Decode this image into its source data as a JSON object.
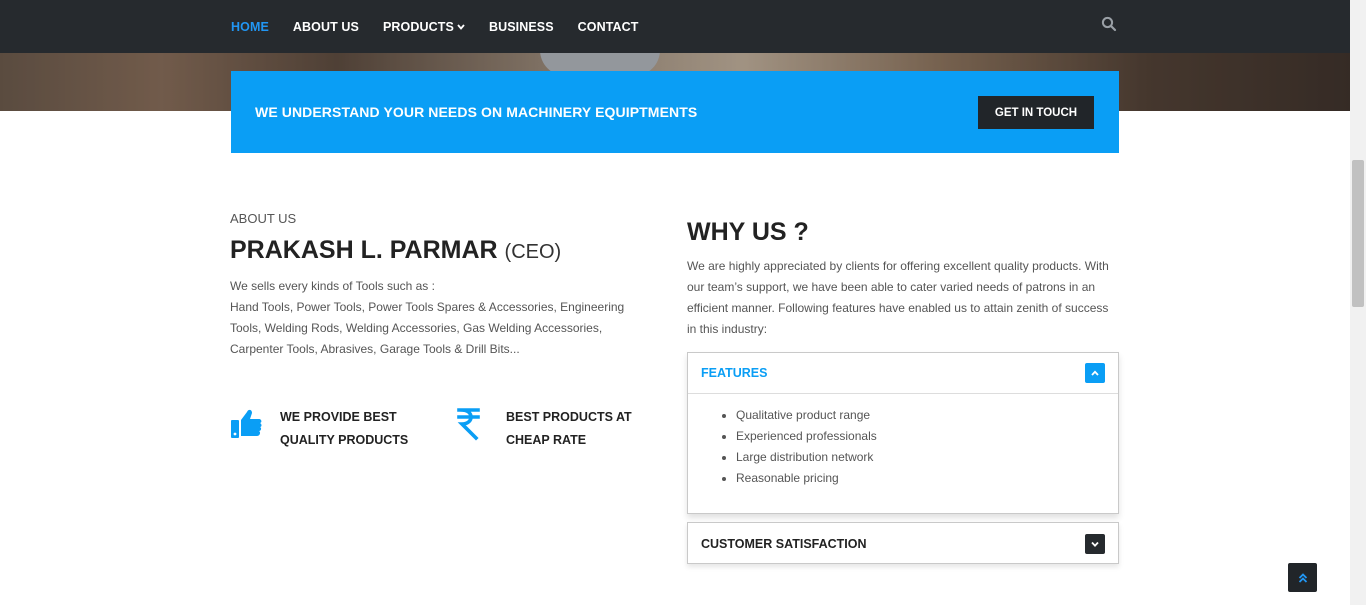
{
  "nav": {
    "items": [
      {
        "label": "HOME"
      },
      {
        "label": "ABOUT US"
      },
      {
        "label": "PRODUCTS"
      },
      {
        "label": "BUSINESS"
      },
      {
        "label": "CONTACT"
      }
    ],
    "active_color": "#2196f3",
    "search_icon": "search-icon"
  },
  "cta": {
    "text": "WE UNDERSTAND YOUR NEEDS ON MACHINERY EQUIPTMENTS",
    "button": "GET IN TOUCH",
    "bg_color": "#0a9ef5"
  },
  "about": {
    "eyebrow": "ABOUT US",
    "name": "PRAKASH L. PARMAR",
    "role": "(CEO)",
    "intro_line1": "We sells every kinds of Tools such as :",
    "intro_line2": "Hand Tools, Power Tools, Power Tools Spares & Accessories, Engineering Tools, Welding Rods, Welding Accessories, Gas Welding Accessories, Carpenter Tools, Abrasives, Garage Tools & Drill Bits...",
    "features": [
      {
        "icon": "thumbs-up-icon",
        "line1": "WE PROVIDE BEST",
        "line2": "QUALITY PRODUCTS"
      },
      {
        "icon": "rupee-icon",
        "line1": "BEST PRODUCTS AT",
        "line2": "CHEAP RATE"
      }
    ]
  },
  "why": {
    "title": "WHY US ?",
    "text": "We are highly appreciated by clients for offering excellent quality products. With our team’s support, we have been able to cater varied needs of patrons in an efficient manner. Following features have enabled us to attain zenith of success in this industry:",
    "accordion": [
      {
        "title": "FEATURES",
        "expanded": true,
        "items": [
          "Qualitative product range",
          "Experienced professionals",
          "Large distribution network",
          "Reasonable pricing"
        ]
      },
      {
        "title": "CUSTOMER SATISFACTION",
        "expanded": false
      }
    ]
  },
  "back_to_top": "double-chevron-up-icon"
}
